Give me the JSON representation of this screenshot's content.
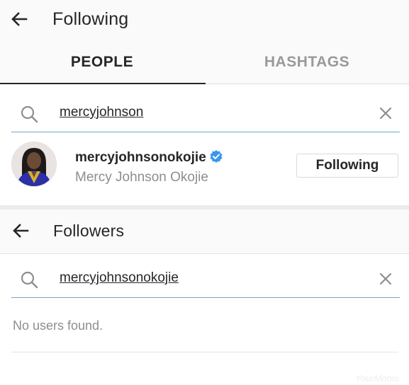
{
  "following_header": {
    "title": "Following"
  },
  "tabs": [
    {
      "label": "PEOPLE"
    },
    {
      "label": "HASHTAGS"
    }
  ],
  "following_search": {
    "query": "mercyjohnson"
  },
  "result": {
    "username": "mercyjohnsonokojie",
    "full_name": "Mercy Johnson Okojie",
    "verified": true,
    "button_label": "Following"
  },
  "followers_header": {
    "title": "Followers"
  },
  "followers_search": {
    "query": "mercyjohnsonokojie"
  },
  "empty_state": {
    "message": "No users found."
  },
  "watermark": "YourMoms",
  "colors": {
    "verified_blue": "#3897f0",
    "search_underline": "#6ea6d0",
    "secondary_text": "#8e8e8e"
  }
}
